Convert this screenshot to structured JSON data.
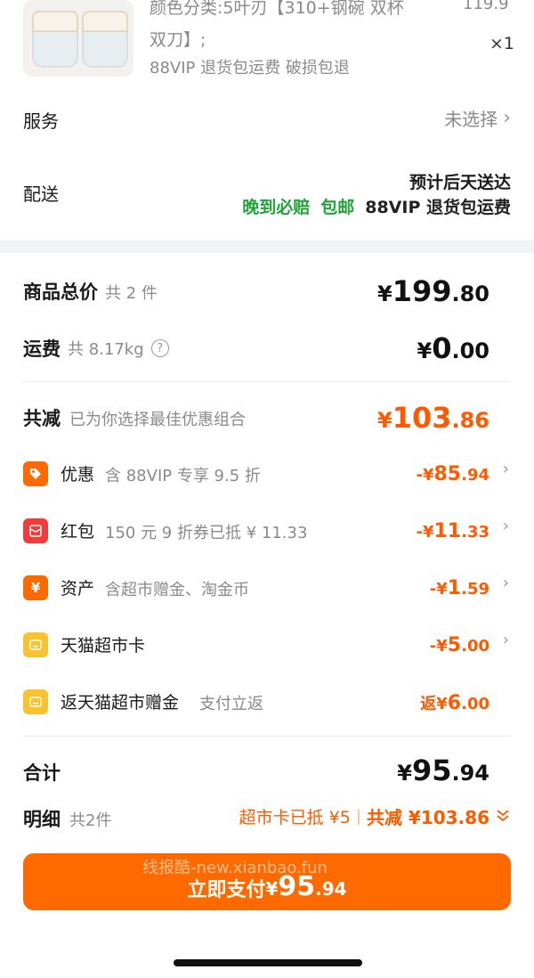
{
  "product": {
    "spec_line1": "颜色分类:5叶刃【310+钢碗 双杯",
    "spec_line2": "双刀】;",
    "tag": "88VIP 退货包运费  破损包退",
    "price": "119.9",
    "qty": "×1"
  },
  "service": {
    "label": "服务",
    "value": "未选择"
  },
  "delivery": {
    "label": "配送",
    "eta": "预计后天送达",
    "badge1": "晚到必赔",
    "badge2": "包邮",
    "badge3": "88VIP 退货包运费"
  },
  "summary": {
    "goods_total_label": "商品总价",
    "goods_total_count": "共 2 件",
    "goods_total_yen": "¥",
    "goods_total_int": "199",
    "goods_total_dec": ".80",
    "shipping_label": "运费",
    "shipping_weight": "共 8.17kg",
    "shipping_help": "?",
    "shipping_yen": "¥",
    "shipping_int": "0",
    "shipping_dec": ".00",
    "discount_label": "共减",
    "discount_desc": "已为你选择最佳优惠组合",
    "discount_yen": "¥",
    "discount_int": "103",
    "discount_dec": ".86"
  },
  "discount_items": [
    {
      "title": "优惠",
      "desc": "含 88VIP 专享 9.5 折",
      "prefix": "-¥",
      "int": "85",
      "dec": ".94",
      "icon_color": "#ff6a00",
      "icon": "tag-icon"
    },
    {
      "title": "红包",
      "desc": "150 元 9 折券已抵 ¥ 11.33",
      "prefix": "-¥",
      "int": "11",
      "dec": ".33",
      "icon_color": "#f23c3c",
      "icon": "red-packet-icon"
    },
    {
      "title": "资产",
      "desc": "含超市赠金、淘金币",
      "prefix": "-¥",
      "int": "1",
      "dec": ".59",
      "icon_color": "#ff6a00",
      "icon": "yen-icon"
    },
    {
      "title": "天猫超市卡",
      "desc": "",
      "prefix": "-¥",
      "int": "5",
      "dec": ".00",
      "icon_color": "#f9c22e",
      "icon": "card-icon"
    },
    {
      "title": "返天猫超市赠金",
      "desc": "支付立返",
      "prefix": "返¥",
      "int": "6",
      "dec": ".00",
      "icon_color": "#f9c22e",
      "icon": "card-icon"
    }
  ],
  "total": {
    "label": "合计",
    "yen": "¥",
    "int": "95",
    "dec": ".94",
    "detail_label": "明细",
    "detail_count": "共2件",
    "detail_card": "超市卡已抵 ¥5",
    "detail_saved": "共减 ¥103.86"
  },
  "pay": {
    "label": "立即支付",
    "yen": "¥",
    "int": "95",
    "dec": ".94",
    "watermark": "线报酷-new.xianbao.fun"
  }
}
